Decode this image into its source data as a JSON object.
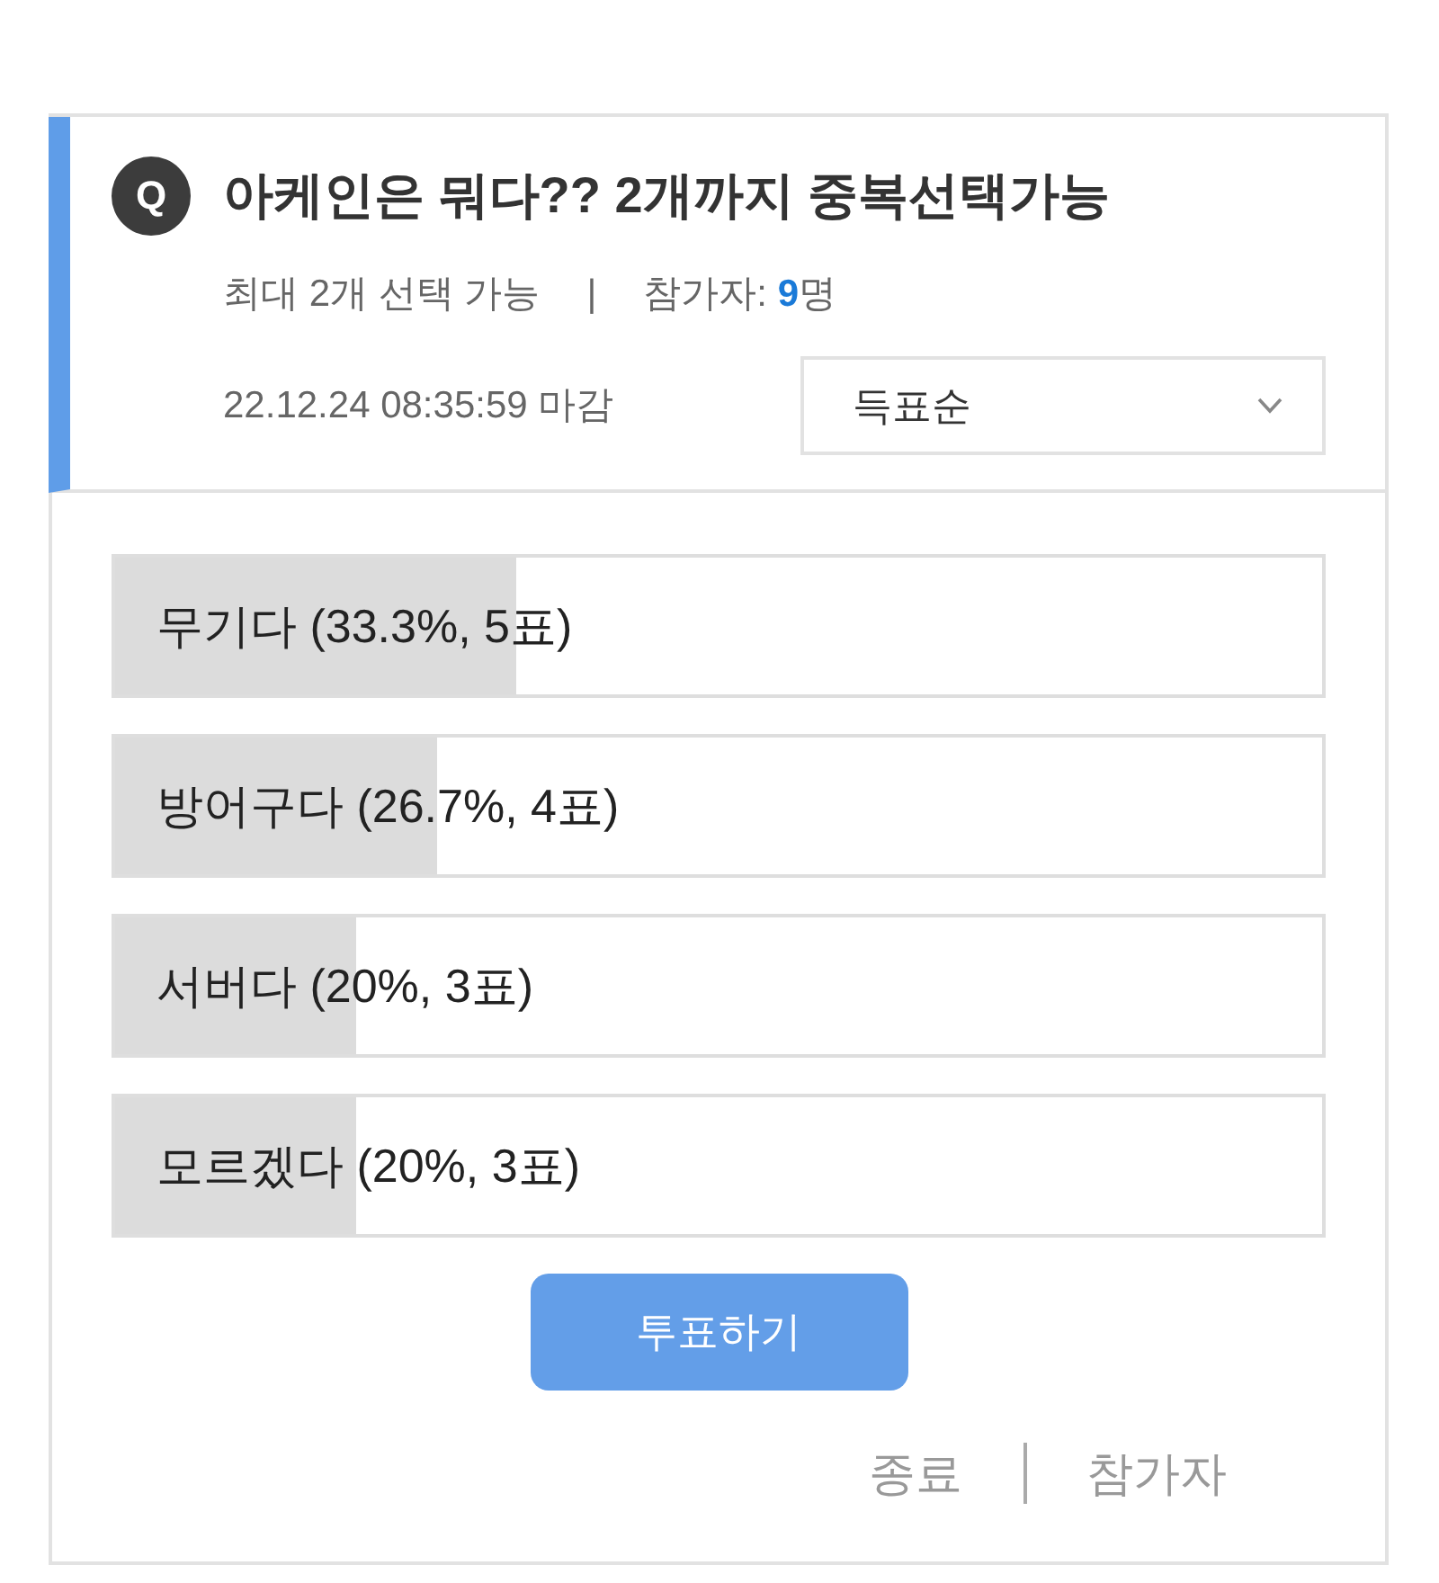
{
  "question": {
    "badge": "Q",
    "title": "아케인은 뭐다?? 2개까지 중복선택가능"
  },
  "meta": {
    "limit": "최대 2개 선택 가능",
    "separator": "|",
    "participants": "참가자: **9**명"
  },
  "deadline": "22.12.24 08:35:59 마감",
  "sort": {
    "value": "득표순"
  },
  "options": [
    {
      "text": "무기다 (33.3%, 5표)",
      "level": 0.333
    },
    {
      "text": "방어구다 (26.7%, 4표)",
      "level": 0.267
    },
    {
      "text": "서버다 (20%, 3표)",
      "level": 0.2
    },
    {
      "text": "모르겠다 (20%, 3표)",
      "level": 0.2
    }
  ],
  "vote_button": "투표하기",
  "footer": {
    "links": [
      "종료",
      "참가자"
    ]
  }
}
